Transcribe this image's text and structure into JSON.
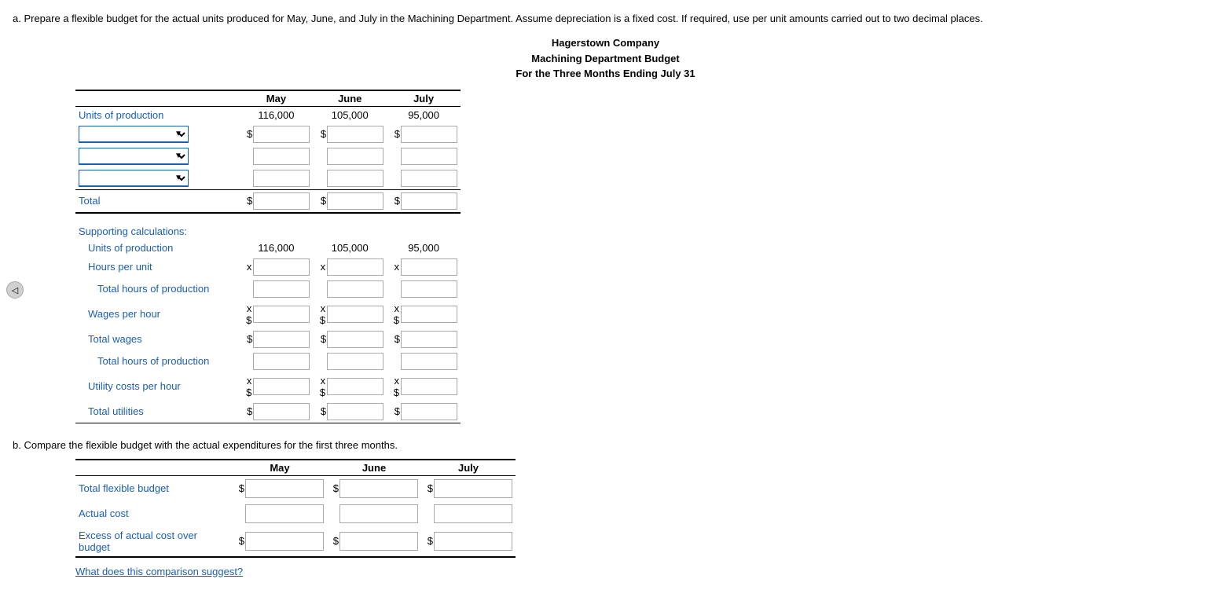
{
  "instruction": {
    "text": "a.  Prepare a flexible budget for the actual units produced for May, June, and July in the Machining Department. Assume depreciation is a fixed cost. If required, use per unit amounts carried out to two decimal places."
  },
  "header": {
    "line1": "Hagerstown Company",
    "line2": "Machining Department Budget",
    "line3": "For the Three Months Ending July 31"
  },
  "columns": {
    "may_label": "May",
    "june_label": "June",
    "july_label": "July"
  },
  "units_row": {
    "label": "Units of production",
    "may_val": "116,000",
    "june_val": "105,000",
    "july_val": "95,000"
  },
  "total_row": {
    "label": "Total"
  },
  "supporting": {
    "title": "Supporting calculations:",
    "units_label": "Units of production",
    "units_may": "116,000",
    "units_june": "105,000",
    "units_july": "95,000",
    "hours_label": "Hours per unit",
    "total_hours_label": "Total hours of production",
    "wages_label": "Wages per hour",
    "total_wages_label": "Total wages",
    "total_hours2_label": "Total hours of production",
    "utility_label": "Utility costs per hour",
    "total_utilities_label": "Total utilities"
  },
  "section_b": {
    "title": "b.  Compare the flexible budget with the actual expenditures for the first three months.",
    "col_may": "May",
    "col_june": "June",
    "col_july": "July",
    "row1_label": "Total flexible budget",
    "row2_label": "Actual cost",
    "row3_label": "Excess of actual cost over budget",
    "what_suggest": "What does this comparison suggest?"
  },
  "icons": {
    "dropdown_arrow": "▼",
    "nav_arrow": "◁"
  }
}
